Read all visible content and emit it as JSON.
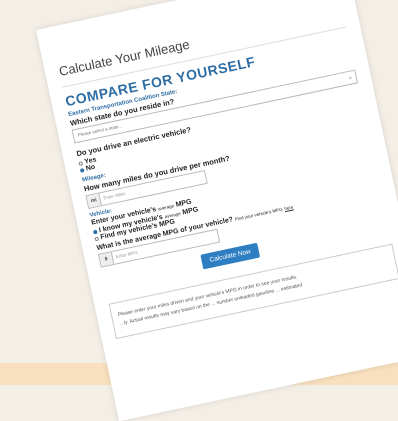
{
  "card": {
    "title": "Calculate Your Mileage",
    "heading": "COMPARE FOR YOURSELF"
  },
  "state": {
    "section": "Eastern Transportation Coalition State:",
    "question": "Which state do you reside in?",
    "placeholder": "Please select a state..."
  },
  "ev": {
    "question": "Do you drive an electric vehicle?",
    "yes": "Yes",
    "no": "No",
    "selected": "No"
  },
  "mileage": {
    "section": "Mileage:",
    "question": "How many miles do you drive per month?",
    "addon": "mi",
    "placeholder": "Enter Miles"
  },
  "vehicle": {
    "section": "Vehicle:",
    "question_a": "Enter your vehicle's",
    "question_b": "average",
    "question_c": "MPG",
    "opt1_a": "I know my vehicle's",
    "opt1_b": "average",
    "opt1_c": "MPG",
    "opt2": "Find my vehicle's MPG",
    "selected": "I know my vehicle's average MPG"
  },
  "mpg": {
    "question": "What is the average MPG of your vehicle?",
    "note": "Find your vehicle's MPG",
    "link": "here",
    "addon": "8",
    "placeholder": "Enter MPG"
  },
  "calc_button": "Calculate Now",
  "result": {
    "line1": "Please enter your miles driven and your vehicle's MPG in order to see your results.",
    "line2": "...ly. Actual results may vary based on the ... number unleaded gasoline ... estimated"
  }
}
